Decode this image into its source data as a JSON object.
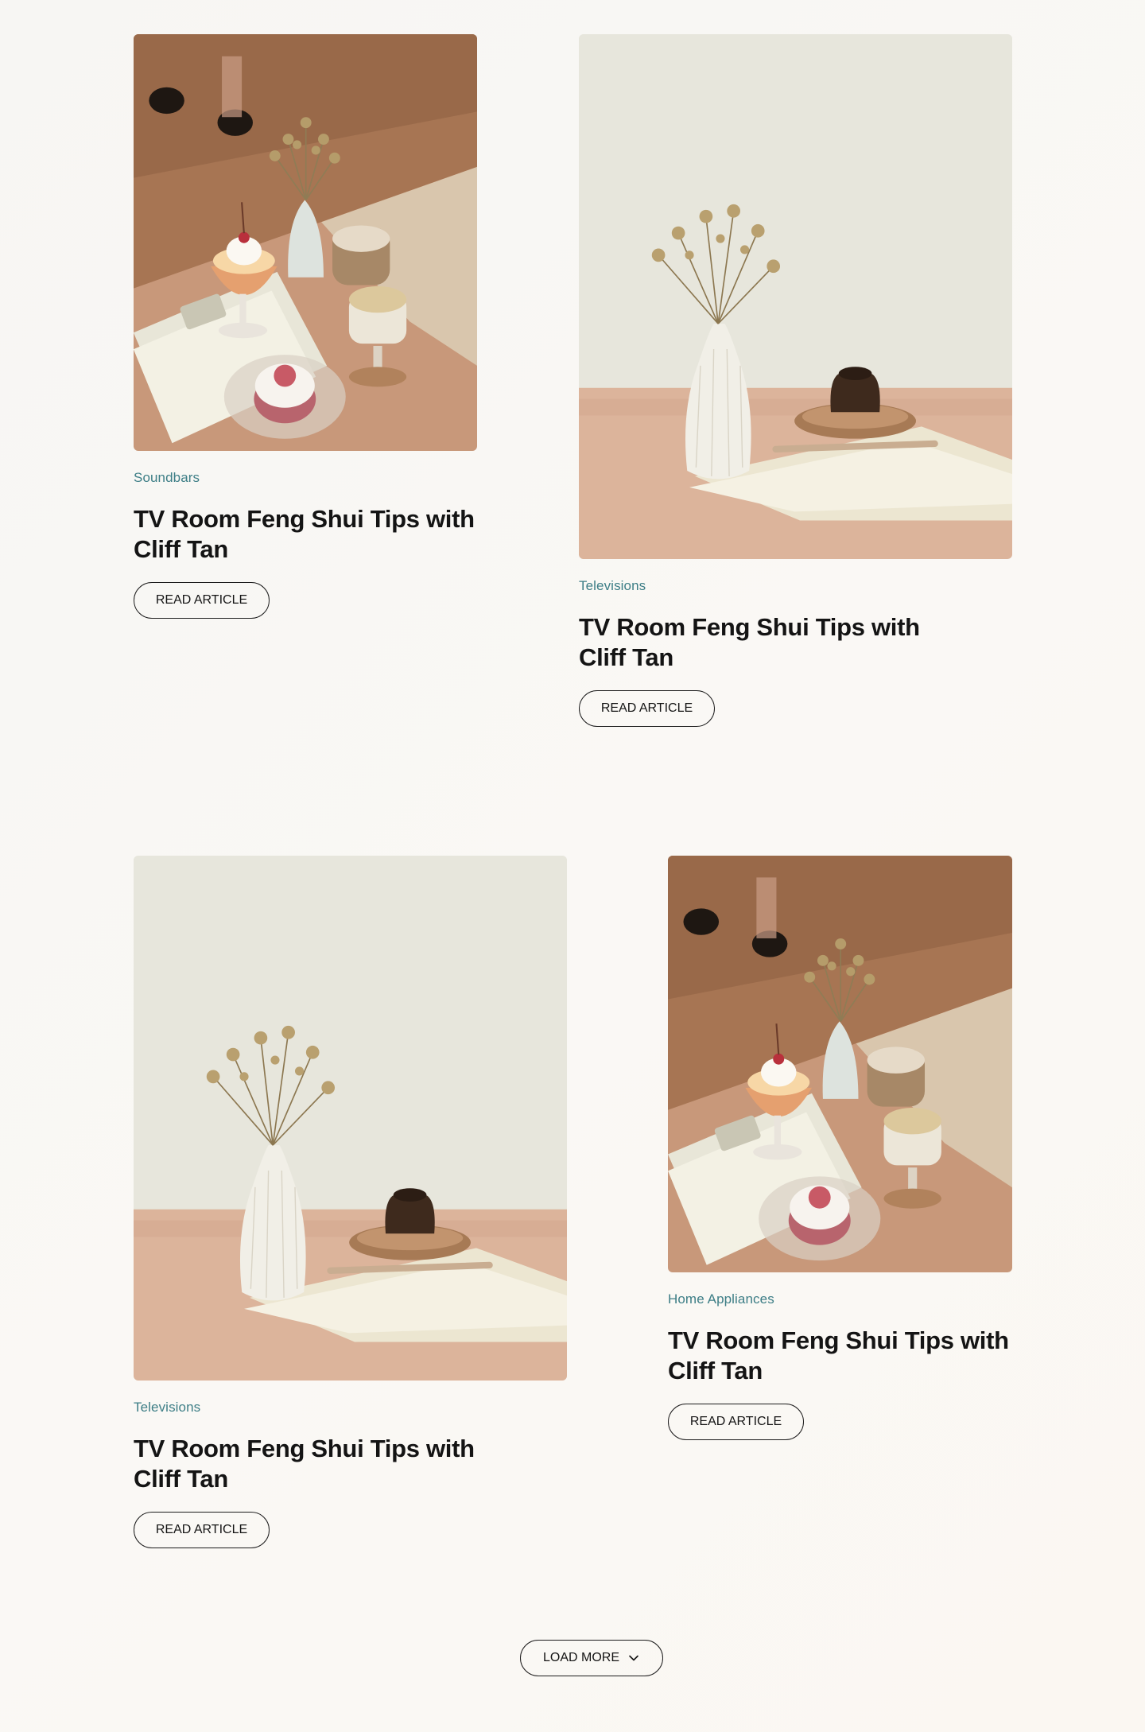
{
  "articles": [
    {
      "category": "Soundbars",
      "title": "TV Room Feng Shui Tips with Cliff Tan",
      "button_label": "READ ARTICLE",
      "image": "cafe-table-dessert-photo"
    },
    {
      "category": "Televisions",
      "title": "TV Room Feng Shui Tips with Cliff Tan",
      "button_label": "READ ARTICLE",
      "image": "vase-and-cake-photo"
    },
    {
      "category": "Televisions",
      "title": "TV Room Feng Shui Tips with Cliff Tan",
      "button_label": "READ ARTICLE",
      "image": "vase-and-cake-photo"
    },
    {
      "category": "Home Appliances",
      "title": "TV Room Feng Shui Tips with Cliff Tan",
      "button_label": "READ ARTICLE",
      "image": "cafe-table-dessert-photo"
    }
  ],
  "load_more": {
    "label": "LOAD MORE",
    "icon": "chevron-down-icon"
  },
  "colors": {
    "category": "#3d7e86",
    "title": "#141414",
    "background": "#f8f7f4"
  }
}
